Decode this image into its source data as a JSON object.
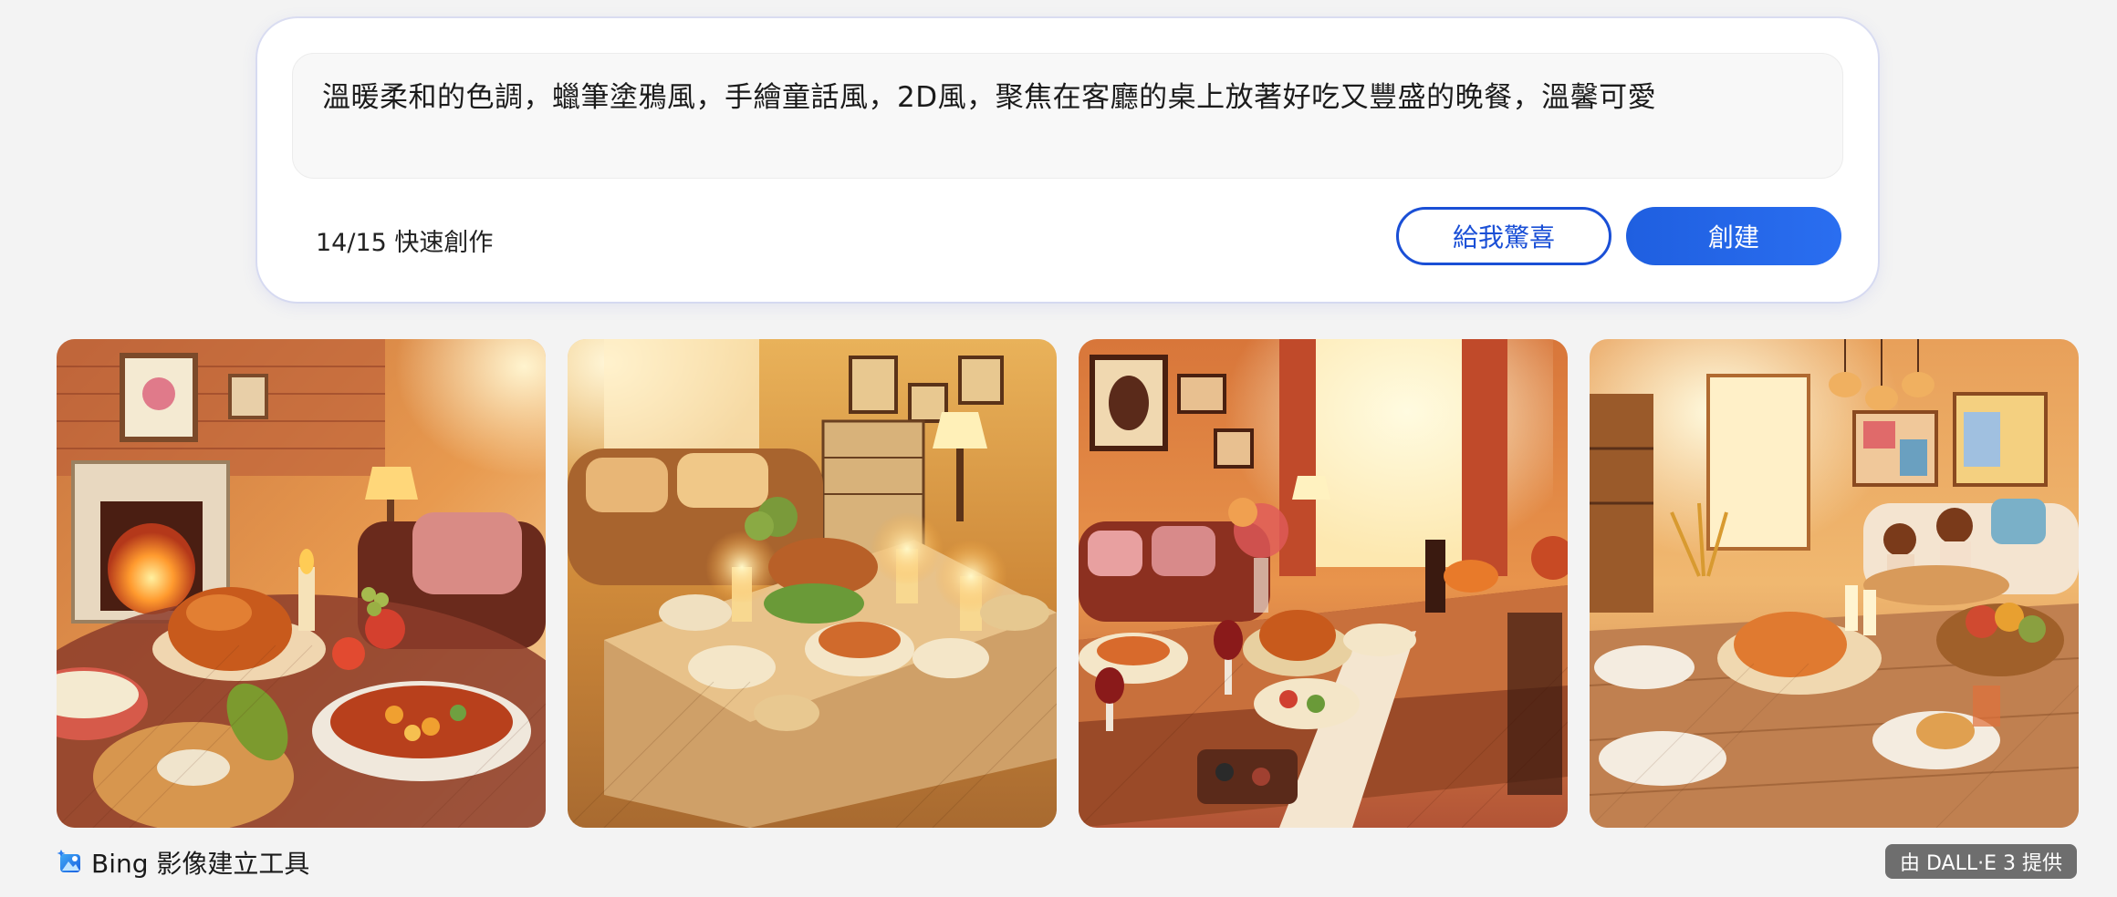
{
  "prompt": {
    "text": "溫暖柔和的色調，蠟筆塗鴉風，手繪童話風，2D風，聚焦在客廳的桌上放著好吃又豐盛的晚餐，溫馨可愛"
  },
  "credits": {
    "label": "14/15 快速創作"
  },
  "buttons": {
    "surprise_label": "給我驚喜",
    "create_label": "創建"
  },
  "colors": {
    "accent": "#1a4fd6",
    "create_bg": "#2463e8",
    "page_bg": "#f3f3f3"
  },
  "footer": {
    "brand_label": "Bing 影像建立工具",
    "powered_by": "由 DALL·E 3 提供",
    "icon": "bing-image-creator-icon"
  }
}
